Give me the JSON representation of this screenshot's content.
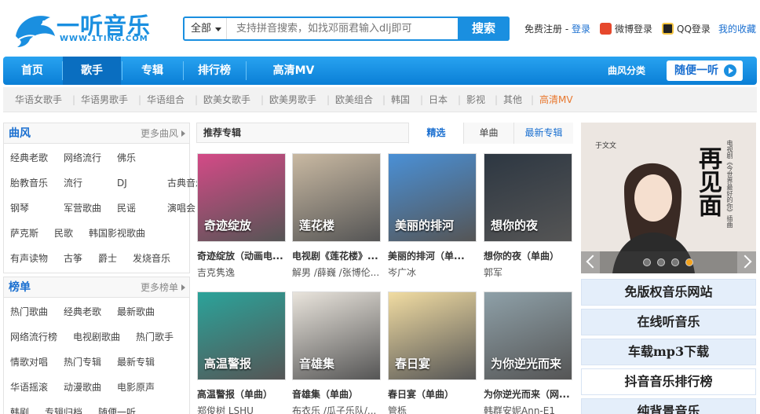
{
  "logo": {
    "name": "一听音乐",
    "sub": "WWW.1TING.COM"
  },
  "search": {
    "scope": "全部",
    "placeholder": "支持拼音搜索，如找邓丽君输入dlj即可",
    "button": "搜索"
  },
  "toplinks": {
    "register_prefix": "免费注册 - ",
    "login": "登录",
    "weibo": "微博登录",
    "qq": "QQ登录",
    "favorites": "我的收藏"
  },
  "nav": {
    "items": [
      "首页",
      "歌手",
      "专辑",
      "排行榜",
      "高清MV"
    ],
    "active": 1,
    "genre_category": "曲风分类",
    "random": "随便一听"
  },
  "subnav": {
    "items": [
      "华语女歌手",
      "华语男歌手",
      "华语组合",
      "欧美女歌手",
      "欧美男歌手",
      "欧美组合",
      "韩国",
      "日本",
      "影视",
      "其他",
      "高清MV"
    ],
    "highlight_color": "#e8762c"
  },
  "genre_box": {
    "title": "曲风",
    "more": "更多曲风",
    "rows": [
      [
        "经典老歌",
        "网络流行",
        "佛乐"
      ],
      [
        "胎教音乐",
        "流行",
        "DJ",
        "古典音乐"
      ],
      [
        "钢琴",
        "军营歌曲",
        "民谣",
        "演唱会"
      ],
      [
        "萨克斯",
        "民歌",
        "韩国影视歌曲"
      ],
      [
        "有声读物",
        "古筝",
        "爵士",
        "发烧音乐"
      ]
    ]
  },
  "chart_box": {
    "title": "榜单",
    "more": "更多榜单",
    "rows": [
      [
        "热门歌曲",
        "经典老歌",
        "最新歌曲"
      ],
      [
        "网络流行榜",
        "电视剧歌曲",
        "热门歌手"
      ],
      [
        "情歌对唱",
        "热门专辑",
        "最新专辑"
      ],
      [
        "华语摇滚",
        "动漫歌曲",
        "电影原声"
      ],
      [
        "韩剧",
        "专辑归档",
        "随便一听"
      ]
    ]
  },
  "albums": {
    "title": "推荐专辑",
    "tabs": [
      "精选",
      "单曲",
      "最新专辑"
    ],
    "items": [
      {
        "title": "奇迹绽放（动画电...",
        "artist": "吉克隽逸",
        "bg": "#d44a87",
        "cover_text": "奇迹绽放"
      },
      {
        "title": "电视剧《莲花楼》...",
        "artist": "解男 /薛巍 /张博伦...",
        "bg": "#c9b9a2",
        "cover_text": "莲花楼"
      },
      {
        "title": "美丽的排河（单...",
        "artist": "岑广冰",
        "bg": "#4a90d6",
        "cover_text": "美丽的排河"
      },
      {
        "title": "想你的夜（单曲）",
        "artist": "郭军",
        "bg": "#2d3742",
        "cover_text": "想你的夜"
      },
      {
        "title": "高温警报（单曲）",
        "artist": "郑俊树 LSHU",
        "bg": "#2ba39a",
        "cover_text": "高温警报"
      },
      {
        "title": "音雄集（单曲）",
        "artist": "布衣乐 /瓜子乐队/...",
        "bg": "#e9e4dc",
        "cover_text": "音雄集"
      },
      {
        "title": "春日宴（单曲）",
        "artist": "管栎",
        "bg": "#f1dca2",
        "cover_text": "春日宴"
      },
      {
        "title": "为你逆光而来（网...",
        "artist": "韩群安妮Ann-E1",
        "bg": "#8ea0a8",
        "cover_text": "为你逆光而来"
      }
    ]
  },
  "banner": {
    "text": "再见面",
    "side": "电视剧《今世界最好的你》插曲",
    "singer": "于文文"
  },
  "promos": [
    "免版权音乐网站",
    "在线听音乐",
    "车载mp3下载",
    "抖音音乐排行榜",
    "纯背景音乐"
  ]
}
